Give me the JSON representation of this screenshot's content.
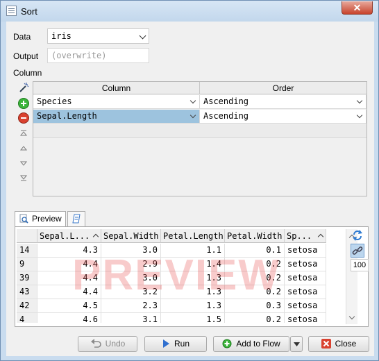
{
  "window": {
    "title": "Sort",
    "close_glyph": "✕"
  },
  "form": {
    "data_label": "Data",
    "data_value": "iris",
    "output_label": "Output",
    "output_placeholder": "(overwrite)",
    "column_label": "Column"
  },
  "sort_table": {
    "headers": [
      "Column",
      "Order"
    ],
    "rows": [
      {
        "column": "Species",
        "order": "Ascending",
        "selected": false
      },
      {
        "column": "Sepal.Length",
        "order": "Ascending",
        "selected": true
      }
    ]
  },
  "tools": [
    "wand-icon",
    "add-icon",
    "remove-icon",
    "move-top-icon",
    "move-up-icon",
    "move-down-icon",
    "move-bottom-icon"
  ],
  "preview": {
    "tab_label": "Preview",
    "watermark": "PREVIEW",
    "columns": [
      "",
      "Sepal.L...",
      "Sepal.Width",
      "Petal.Length",
      "Petal.Width",
      "Sp..."
    ],
    "rows": [
      [
        "14",
        "4.3",
        "3.0",
        "1.1",
        "0.1",
        "setosa"
      ],
      [
        "9",
        "4.4",
        "2.9",
        "1.4",
        "0.2",
        "setosa"
      ],
      [
        "39",
        "4.4",
        "3.0",
        "1.3",
        "0.2",
        "setosa"
      ],
      [
        "43",
        "4.4",
        "3.2",
        "1.3",
        "0.2",
        "setosa"
      ],
      [
        "42",
        "4.5",
        "2.3",
        "1.3",
        "0.3",
        "setosa"
      ],
      [
        "4",
        "4.6",
        "3.1",
        "1.5",
        "0.2",
        "setosa"
      ]
    ],
    "row_limit": "100"
  },
  "buttons": {
    "undo": "Undo",
    "run": "Run",
    "add_to_flow": "Add to Flow",
    "close": "Close"
  },
  "colors": {
    "selection": "#9dc3de",
    "add_green": "#3bb43b",
    "remove_red": "#d9412f",
    "close_red": "#d9412f",
    "run_blue": "#2f6fcf"
  }
}
